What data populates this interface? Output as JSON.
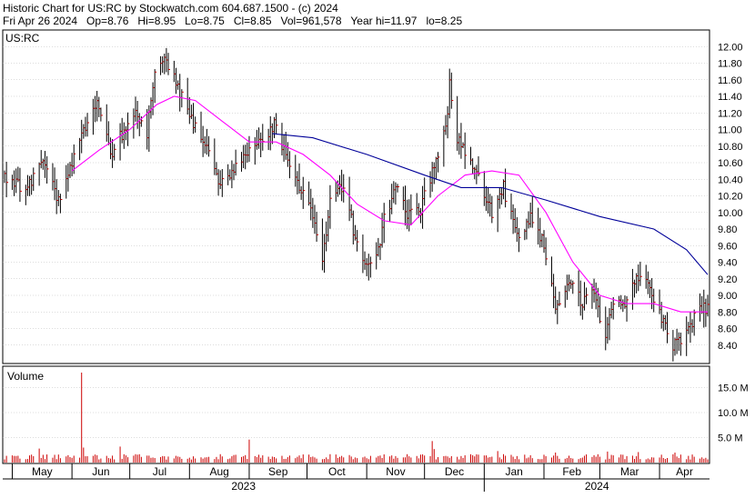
{
  "header": {
    "title": "Historic Chart for US:RC by Stockwatch.com 604.687.1500 - (c) 2024",
    "stats": "Fri Apr 26 2024   Op=8.76   Hi=8.95   Lo=8.75   Cl=8.85   Vol=961,578   Year hi=11.97   lo=8.25"
  },
  "price_panel": {
    "symbol": "US:RC"
  },
  "volume_panel": {
    "label": "Volume"
  },
  "colors": {
    "bar": "#000000",
    "close_tick": "#cc0000",
    "ma_short": "#ff00ff",
    "ma_long": "#000099",
    "volume_bar": "#cc0000",
    "grid": "#bbbbbb"
  },
  "chart_data": [
    {
      "type": "ohlc",
      "symbol": "US:RC",
      "date_range": [
        "2023-04-27",
        "2024-04-26"
      ],
      "y_axis": {
        "side": "right",
        "ylim": [
          8.2,
          12.1
        ],
        "ticks": [
          "12.00",
          "11.80",
          "11.60",
          "11.40",
          "11.20",
          "11.00",
          "10.80",
          "10.60",
          "10.40",
          "10.20",
          "10.00",
          "9.80",
          "9.60",
          "9.40",
          "9.20",
          "9.00",
          "8.80",
          "8.60",
          "8.40"
        ]
      },
      "x_axis": {
        "months": [
          "May",
          "Jun",
          "Jul",
          "Aug",
          "Sep",
          "Oct",
          "Nov",
          "Dec",
          "Jan",
          "Feb",
          "Mar",
          "Apr"
        ],
        "years": [
          "2023",
          "2024"
        ]
      },
      "grid": true,
      "close_path": [
        {
          "date": "2023-04-27",
          "close": 10.4
        },
        {
          "date": "2023-05-08",
          "close": 10.3
        },
        {
          "date": "2023-05-18",
          "close": 10.6
        },
        {
          "date": "2023-05-26",
          "close": 10.1
        },
        {
          "date": "2023-06-05",
          "close": 10.95
        },
        {
          "date": "2023-06-14",
          "close": 11.3
        },
        {
          "date": "2023-06-21",
          "close": 10.7
        },
        {
          "date": "2023-07-03",
          "close": 11.2
        },
        {
          "date": "2023-07-10",
          "close": 10.95
        },
        {
          "date": "2023-07-14",
          "close": 11.75
        },
        {
          "date": "2023-07-20",
          "close": 11.85
        },
        {
          "date": "2023-07-26",
          "close": 11.5
        },
        {
          "date": "2023-08-03",
          "close": 11.1
        },
        {
          "date": "2023-08-11",
          "close": 10.7
        },
        {
          "date": "2023-08-17",
          "close": 10.35
        },
        {
          "date": "2023-08-24",
          "close": 10.5
        },
        {
          "date": "2023-09-01",
          "close": 10.8
        },
        {
          "date": "2023-09-08",
          "close": 10.9
        },
        {
          "date": "2023-09-14",
          "close": 11.05
        },
        {
          "date": "2023-09-21",
          "close": 10.6
        },
        {
          "date": "2023-10-02",
          "close": 10.1
        },
        {
          "date": "2023-10-09",
          "close": 9.4
        },
        {
          "date": "2023-10-13",
          "close": 10.2
        },
        {
          "date": "2023-10-20",
          "close": 10.3
        },
        {
          "date": "2023-10-25",
          "close": 9.8
        },
        {
          "date": "2023-11-01",
          "close": 9.3
        },
        {
          "date": "2023-11-06",
          "close": 9.45
        },
        {
          "date": "2023-11-10",
          "close": 9.9
        },
        {
          "date": "2023-11-16",
          "close": 10.3
        },
        {
          "date": "2023-11-22",
          "close": 9.95
        },
        {
          "date": "2023-11-29",
          "close": 10.05
        },
        {
          "date": "2023-12-06",
          "close": 10.55
        },
        {
          "date": "2023-12-13",
          "close": 11.2
        },
        {
          "date": "2023-12-14",
          "close": 11.55
        },
        {
          "date": "2023-12-18",
          "close": 10.9
        },
        {
          "date": "2023-12-26",
          "close": 10.6
        },
        {
          "date": "2024-01-05",
          "close": 10.0
        },
        {
          "date": "2024-01-11",
          "close": 10.3
        },
        {
          "date": "2024-01-18",
          "close": 9.7
        },
        {
          "date": "2024-01-25",
          "close": 9.95
        },
        {
          "date": "2024-02-01",
          "close": 9.6
        },
        {
          "date": "2024-02-07",
          "close": 8.85
        },
        {
          "date": "2024-02-14",
          "close": 9.2
        },
        {
          "date": "2024-02-21",
          "close": 8.9
        },
        {
          "date": "2024-02-27",
          "close": 9.05
        },
        {
          "date": "2024-03-04",
          "close": 8.45
        },
        {
          "date": "2024-03-08",
          "close": 8.95
        },
        {
          "date": "2024-03-14",
          "close": 8.8
        },
        {
          "date": "2024-03-20",
          "close": 9.25
        },
        {
          "date": "2024-03-26",
          "close": 9.1
        },
        {
          "date": "2024-04-02",
          "close": 8.7
        },
        {
          "date": "2024-04-08",
          "close": 8.4
        },
        {
          "date": "2024-04-15",
          "close": 8.55
        },
        {
          "date": "2024-04-22",
          "close": 8.85
        },
        {
          "date": "2024-04-26",
          "close": 8.85
        }
      ],
      "moving_averages": [
        {
          "color": "#ff00ff",
          "points": [
            {
              "date": "2023-06-01",
              "value": 10.5
            },
            {
              "date": "2023-06-15",
              "value": 10.75
            },
            {
              "date": "2023-07-01",
              "value": 11.0
            },
            {
              "date": "2023-07-15",
              "value": 11.3
            },
            {
              "date": "2023-07-24",
              "value": 11.4
            },
            {
              "date": "2023-08-04",
              "value": 11.35
            },
            {
              "date": "2023-08-18",
              "value": 11.1
            },
            {
              "date": "2023-09-01",
              "value": 10.85
            },
            {
              "date": "2023-09-15",
              "value": 10.85
            },
            {
              "date": "2023-09-29",
              "value": 10.7
            },
            {
              "date": "2023-10-13",
              "value": 10.45
            },
            {
              "date": "2023-10-27",
              "value": 10.1
            },
            {
              "date": "2023-11-10",
              "value": 9.9
            },
            {
              "date": "2023-11-24",
              "value": 9.85
            },
            {
              "date": "2023-12-08",
              "value": 10.2
            },
            {
              "date": "2023-12-22",
              "value": 10.45
            },
            {
              "date": "2024-01-05",
              "value": 10.5
            },
            {
              "date": "2024-01-19",
              "value": 10.45
            },
            {
              "date": "2024-02-02",
              "value": 10.0
            },
            {
              "date": "2024-02-16",
              "value": 9.4
            },
            {
              "date": "2024-03-01",
              "value": 9.0
            },
            {
              "date": "2024-03-15",
              "value": 8.9
            },
            {
              "date": "2024-03-29",
              "value": 8.9
            },
            {
              "date": "2024-04-12",
              "value": 8.8
            },
            {
              "date": "2024-04-26",
              "value": 8.8
            }
          ]
        },
        {
          "color": "#000099",
          "points": [
            {
              "date": "2023-09-13",
              "value": 10.95
            },
            {
              "date": "2023-10-04",
              "value": 10.9
            },
            {
              "date": "2023-11-01",
              "value": 10.7
            },
            {
              "date": "2023-12-01",
              "value": 10.45
            },
            {
              "date": "2023-12-20",
              "value": 10.3
            },
            {
              "date": "2024-01-10",
              "value": 10.3
            },
            {
              "date": "2024-02-02",
              "value": 10.15
            },
            {
              "date": "2024-03-01",
              "value": 9.95
            },
            {
              "date": "2024-03-29",
              "value": 9.8
            },
            {
              "date": "2024-04-15",
              "value": 9.55
            },
            {
              "date": "2024-04-26",
              "value": 9.25
            }
          ]
        }
      ]
    },
    {
      "type": "bar",
      "title": "Volume",
      "y_axis": {
        "side": "right",
        "ylim": [
          0,
          18
        ],
        "unit": "M",
        "ticks": [
          "15.0 M",
          "10.0 M",
          "5.0 M"
        ]
      },
      "baseline_volume_m": 1.2,
      "spikes": [
        {
          "date": "2023-05-15",
          "value": 2.8
        },
        {
          "date": "2023-06-06",
          "value": 18.0
        },
        {
          "date": "2023-06-07",
          "value": 3.0
        },
        {
          "date": "2023-06-26",
          "value": 3.2
        },
        {
          "date": "2023-09-01",
          "value": 4.6
        },
        {
          "date": "2023-12-05",
          "value": 4.3
        },
        {
          "date": "2023-12-06",
          "value": 2.7
        },
        {
          "date": "2024-01-08",
          "value": 2.3
        },
        {
          "date": "2024-02-07",
          "value": 2.0
        },
        {
          "date": "2024-03-05",
          "value": 2.2
        },
        {
          "date": "2024-03-21",
          "value": 2.1
        },
        {
          "date": "2024-04-09",
          "value": 2.0
        }
      ]
    }
  ]
}
